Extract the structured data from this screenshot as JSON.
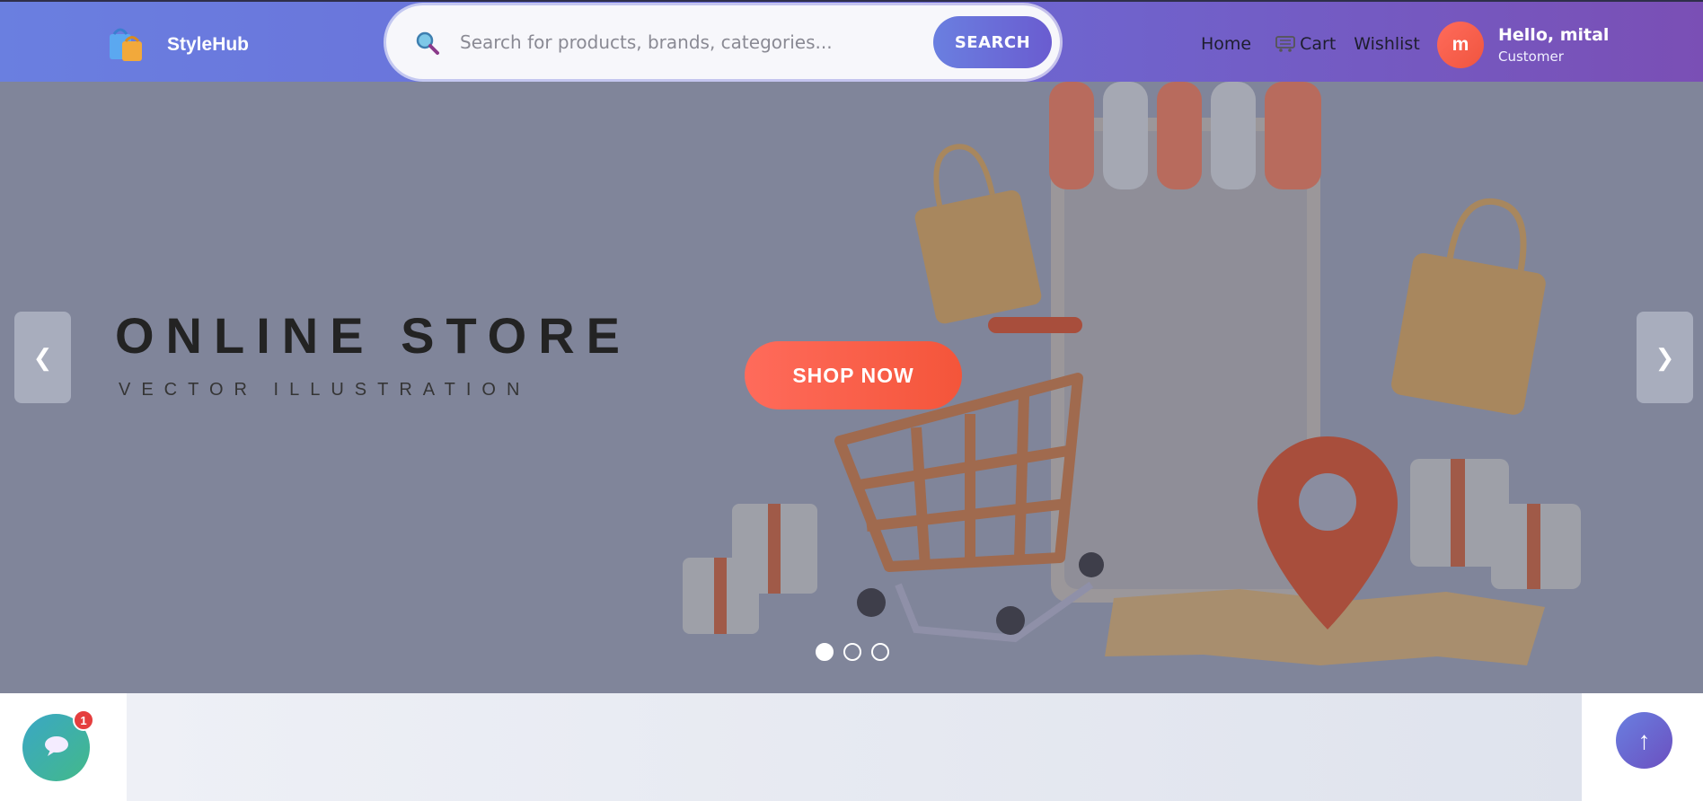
{
  "header": {
    "brand": "StyleHub",
    "search": {
      "placeholder": "Search for products, brands, categories...",
      "value": "",
      "button_label": "SEARCH"
    },
    "nav": {
      "home": "Home",
      "cart": "Cart",
      "wishlist": "Wishlist"
    },
    "user": {
      "avatar_initial": "m",
      "greeting": "Hello, mital",
      "role": "Customer"
    }
  },
  "hero": {
    "title": "ONLINE STORE",
    "subtitle": "VECTOR ILLUSTRATION",
    "cta_label": "SHOP NOW",
    "prev_label": "❮",
    "next_label": "❯",
    "slides": [
      {
        "active": true
      },
      {
        "active": false
      },
      {
        "active": false
      }
    ]
  },
  "floating": {
    "chat_badge_count": "1",
    "scroll_top_label": "↑"
  },
  "icons": {
    "logo": "shopping-bags-icon",
    "search": "magnifier-icon",
    "cart": "cart-icon",
    "chat": "chat-bubble-icon"
  },
  "colors": {
    "header_start": "#6a7fe0",
    "header_end": "#7a4fb5",
    "accent": "#f4553a",
    "hero_bg": "#80859a"
  }
}
